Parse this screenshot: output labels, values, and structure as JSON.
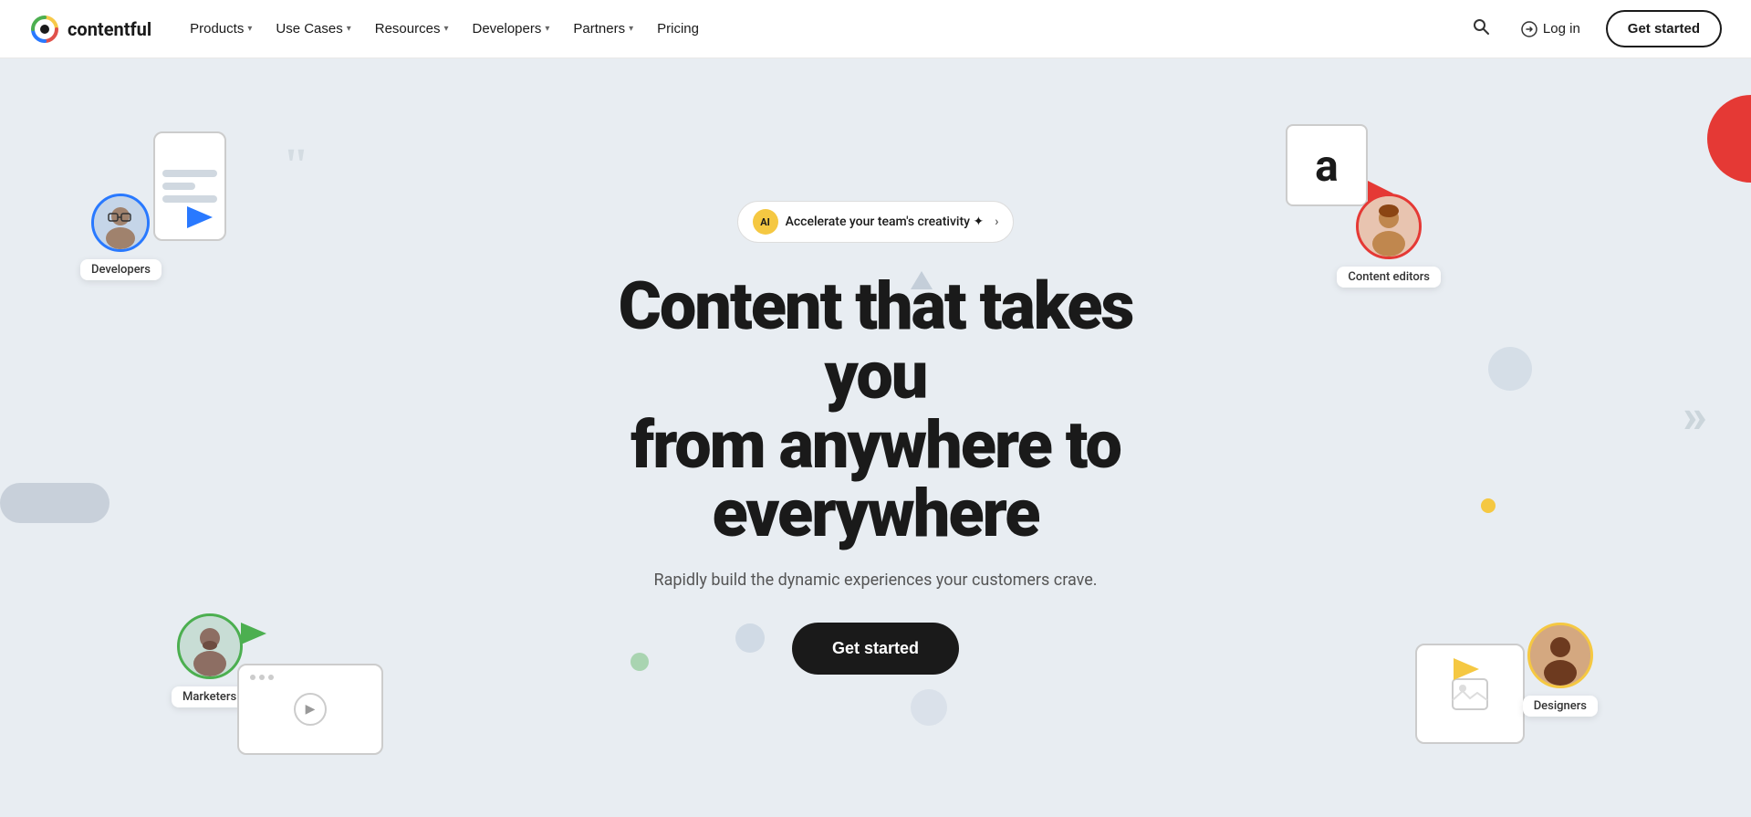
{
  "nav": {
    "logo_text": "contentful",
    "links": [
      {
        "label": "Products",
        "has_chevron": true
      },
      {
        "label": "Use Cases",
        "has_chevron": true
      },
      {
        "label": "Resources",
        "has_chevron": true
      },
      {
        "label": "Developers",
        "has_chevron": true
      },
      {
        "label": "Partners",
        "has_chevron": true
      },
      {
        "label": "Pricing",
        "has_chevron": false
      }
    ],
    "login_label": "Log in",
    "get_started_label": "Get started"
  },
  "hero": {
    "ai_badge_label": "AI",
    "ai_badge_text": "Accelerate your team's creativity ✦",
    "title_line1": "Content that takes you",
    "title_line2": "from anywhere to",
    "title_line3": "everywhere",
    "subtitle": "Rapidly build the dynamic experiences your customers crave.",
    "cta_label": "Get started"
  },
  "personas": {
    "developers": {
      "label": "Developers"
    },
    "marketers": {
      "label": "Marketers"
    },
    "content_editors": {
      "label": "Content editors"
    },
    "designers": {
      "label": "Designers"
    }
  },
  "icons": {
    "search": "🔍",
    "login_arrow": "→",
    "chevron": "▾",
    "play": "▶",
    "image": "🖼",
    "blue_arrow": "▶",
    "green_arrow": "▶",
    "red_cursor": "▶",
    "yellow_arrow": "▶"
  }
}
